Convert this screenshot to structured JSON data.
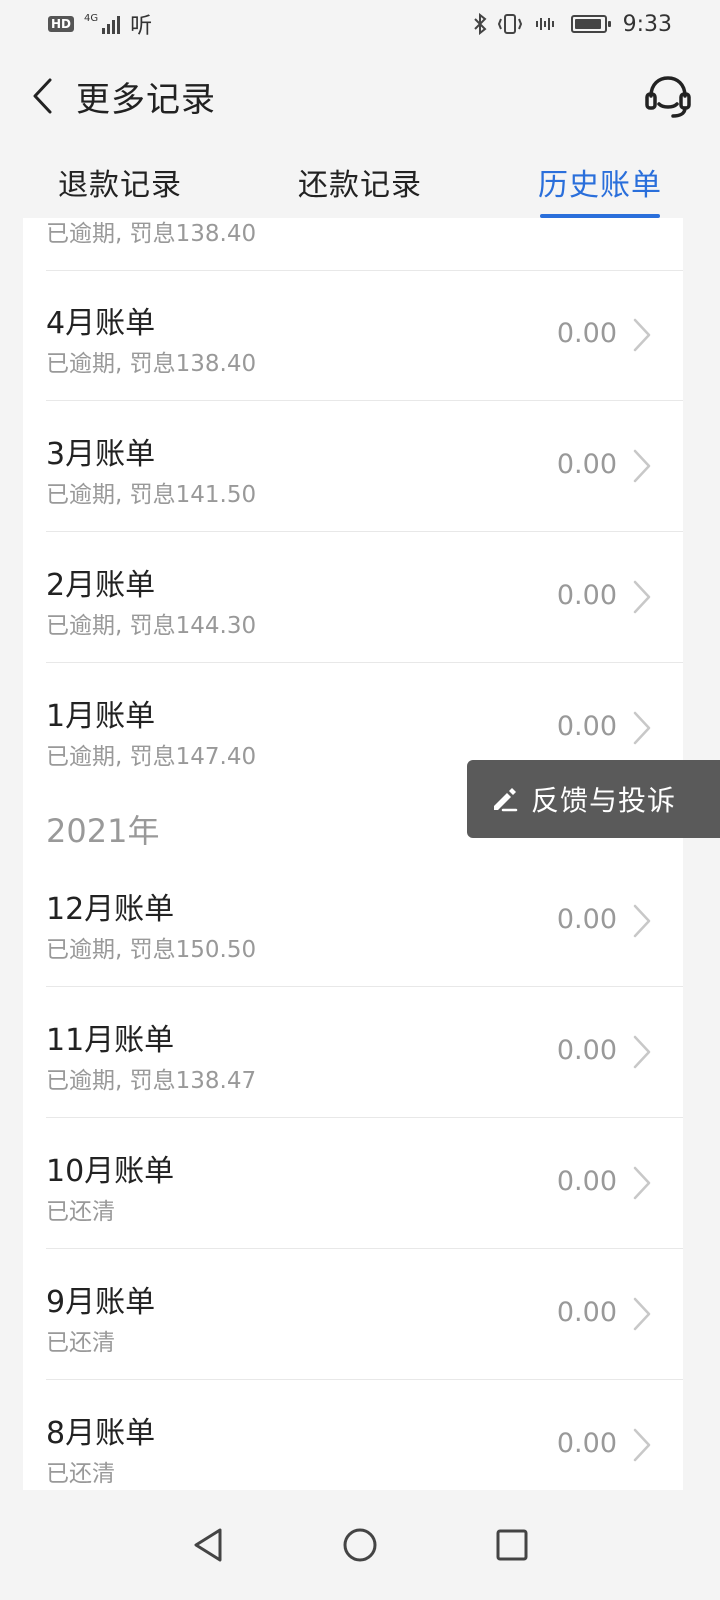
{
  "status_bar": {
    "hd": "HD",
    "network": "4G",
    "extra": "听",
    "time": "9:33"
  },
  "app_bar": {
    "title": "更多记录"
  },
  "tabs": [
    {
      "label": "退款记录",
      "active": false
    },
    {
      "label": "还款记录",
      "active": false
    },
    {
      "label": "历史账单",
      "active": true
    }
  ],
  "partial_row": {
    "sub": "已逾期, 罚息138.40"
  },
  "group_2022": {
    "rows": [
      {
        "title": "4月账单",
        "sub": "已逾期, 罚息138.40",
        "amount": "0.00"
      },
      {
        "title": "3月账单",
        "sub": "已逾期, 罚息141.50",
        "amount": "0.00"
      },
      {
        "title": "2月账单",
        "sub": "已逾期, 罚息144.30",
        "amount": "0.00"
      },
      {
        "title": "1月账单",
        "sub": "已逾期, 罚息147.40",
        "amount": "0.00"
      }
    ]
  },
  "group_2021": {
    "year": "2021年",
    "rows": [
      {
        "title": "12月账单",
        "sub": "已逾期, 罚息150.50",
        "amount": "0.00"
      },
      {
        "title": "11月账单",
        "sub": "已逾期, 罚息138.47",
        "amount": "0.00"
      },
      {
        "title": "10月账单",
        "sub": "已还清",
        "amount": "0.00"
      },
      {
        "title": "9月账单",
        "sub": "已还清",
        "amount": "0.00"
      },
      {
        "title": "8月账单",
        "sub": "已还清",
        "amount": "0.00"
      }
    ]
  },
  "feedback": {
    "label": "反馈与投诉"
  },
  "colors": {
    "accent": "#2a6fdb",
    "muted": "#999999",
    "feedback_bg": "#5a5a5a"
  }
}
